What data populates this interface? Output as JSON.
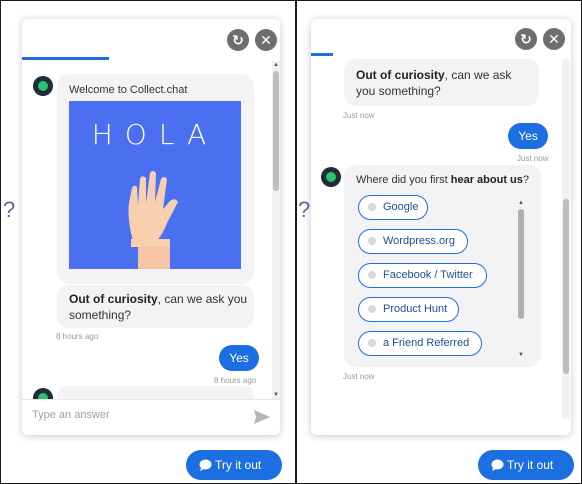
{
  "left": {
    "help_glyph": "?",
    "welcome_text": "Welcome to Collect.chat",
    "image_text": "HOLA",
    "question_bold": "Out of curiosity",
    "question_rest": ", can we ask you something?",
    "question_time": "8 hours ago",
    "user_reply": "Yes",
    "user_reply_time": "8 hours ago",
    "input_placeholder": "Type an answer",
    "try_button": "Try it out"
  },
  "right": {
    "help_glyph": "?",
    "question_bold": "Out of curiosity",
    "question_rest": ", can we ask you something?",
    "question_time": "Just now",
    "user_reply": "Yes",
    "user_reply_time": "Just now",
    "prompt_pre": "Where did you first ",
    "prompt_bold": "hear about us",
    "prompt_post": "?",
    "options": [
      "Google",
      "Wordpress.org",
      "Facebook / Twitter",
      "Product Hunt",
      "a Friend Referred"
    ],
    "prompt_time": "Just now",
    "try_button": "Try it out"
  },
  "colors": {
    "accent": "#1c6fe0",
    "image_bg": "#4a6ff0",
    "avatar_dot": "#27c46b"
  },
  "icons": [
    "refresh-icon",
    "close-icon",
    "send-icon",
    "chat-bubble-icon"
  ]
}
